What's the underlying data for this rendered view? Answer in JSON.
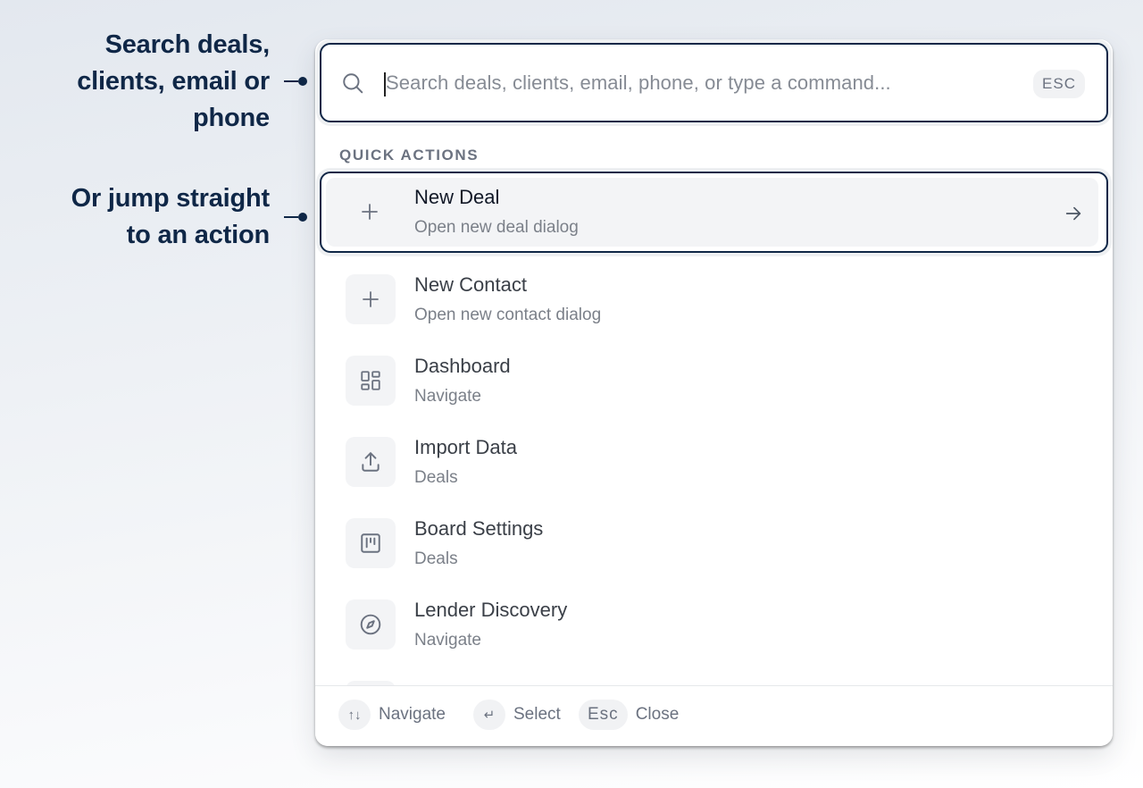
{
  "callouts": {
    "search_lines": [
      "Search deals,",
      "clients, email or",
      "phone"
    ],
    "action_lines": [
      "Or jump straight",
      "to an action"
    ]
  },
  "search": {
    "placeholder": "Search deals, clients, email, phone, or type a command...",
    "value": "",
    "esc_label": "ESC"
  },
  "section_label": "QUICK ACTIONS",
  "items": [
    {
      "title": "New Deal",
      "subtitle": "Open new deal dialog",
      "icon": "plus-icon",
      "active": true
    },
    {
      "title": "New Contact",
      "subtitle": "Open new contact dialog",
      "icon": "plus-icon",
      "active": false
    },
    {
      "title": "Dashboard",
      "subtitle": "Navigate",
      "icon": "dashboard-grid-icon",
      "active": false
    },
    {
      "title": "Import Data",
      "subtitle": "Deals",
      "icon": "upload-icon",
      "active": false
    },
    {
      "title": "Board Settings",
      "subtitle": "Deals",
      "icon": "kanban-board-icon",
      "active": false
    },
    {
      "title": "Lender Discovery",
      "subtitle": "Navigate",
      "icon": "compass-icon",
      "active": false
    }
  ],
  "footer": {
    "navigate_key": "↑↓",
    "navigate_label": "Navigate",
    "select_key": "↵",
    "select_label": "Select",
    "close_key": "Esc",
    "close_label": "Close"
  },
  "colors": {
    "accent": "#0f2747",
    "muted_text": "#6b7280",
    "item_bg": "#f3f4f6"
  }
}
